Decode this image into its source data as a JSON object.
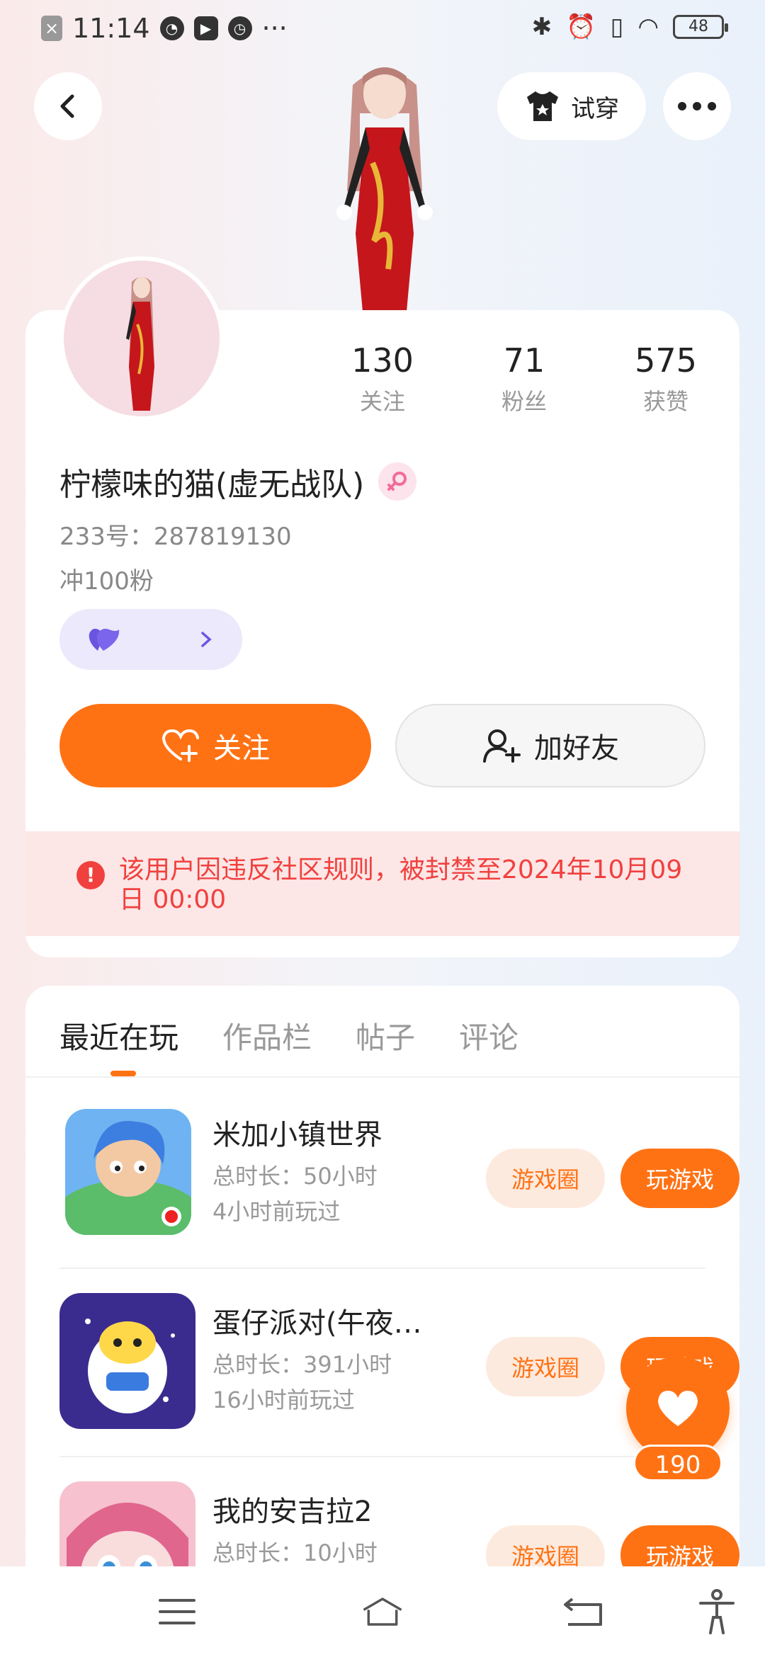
{
  "status_bar": {
    "time": "11:14",
    "more": "···",
    "battery": "48"
  },
  "header": {
    "tryon_label": "试穿"
  },
  "profile": {
    "stats": [
      {
        "value": "130",
        "label": "关注"
      },
      {
        "value": "71",
        "label": "粉丝"
      },
      {
        "value": "575",
        "label": "获赞"
      }
    ],
    "username": "柠檬味的猫(虚无战队)",
    "uid": "233号：287819130",
    "bio": "冲100粉",
    "follow_label": "关注",
    "add_friend_label": "加好友",
    "ban_notice": "该用户因违反社区规则，被封禁至2024年10月09日 00:00"
  },
  "tabs": [
    {
      "label": "最近在玩",
      "active": true
    },
    {
      "label": "作品栏",
      "active": false
    },
    {
      "label": "帖子",
      "active": false
    },
    {
      "label": "评论",
      "active": false
    }
  ],
  "games": [
    {
      "name": "米加小镇世界",
      "total": "总时长：50小时",
      "last": "4小时前玩过",
      "circle_label": "游戏圈",
      "play_label": "玩游戏"
    },
    {
      "name": "蛋仔派对(午夜…",
      "total": "总时长：391小时",
      "last": "16小时前玩过",
      "circle_label": "游戏圈",
      "play_label": "玩游戏"
    },
    {
      "name": "我的安吉拉2",
      "total": "总时长：10小时",
      "last": "",
      "circle_label": "游戏圈",
      "play_label": "玩游戏"
    }
  ],
  "like_count": "190",
  "colors": {
    "accent": "#ff7214",
    "warning": "#f0413f",
    "warning_bg": "#fde6e6"
  },
  "icons": [
    "back-icon",
    "tshirt-icon",
    "more-icon",
    "female-icon",
    "heart-badge-icon",
    "chevron-right-icon",
    "heart-plus-icon",
    "user-plus-icon",
    "alert-icon",
    "heart-icon",
    "menu-icon",
    "home-icon",
    "return-icon",
    "accessibility-icon"
  ]
}
